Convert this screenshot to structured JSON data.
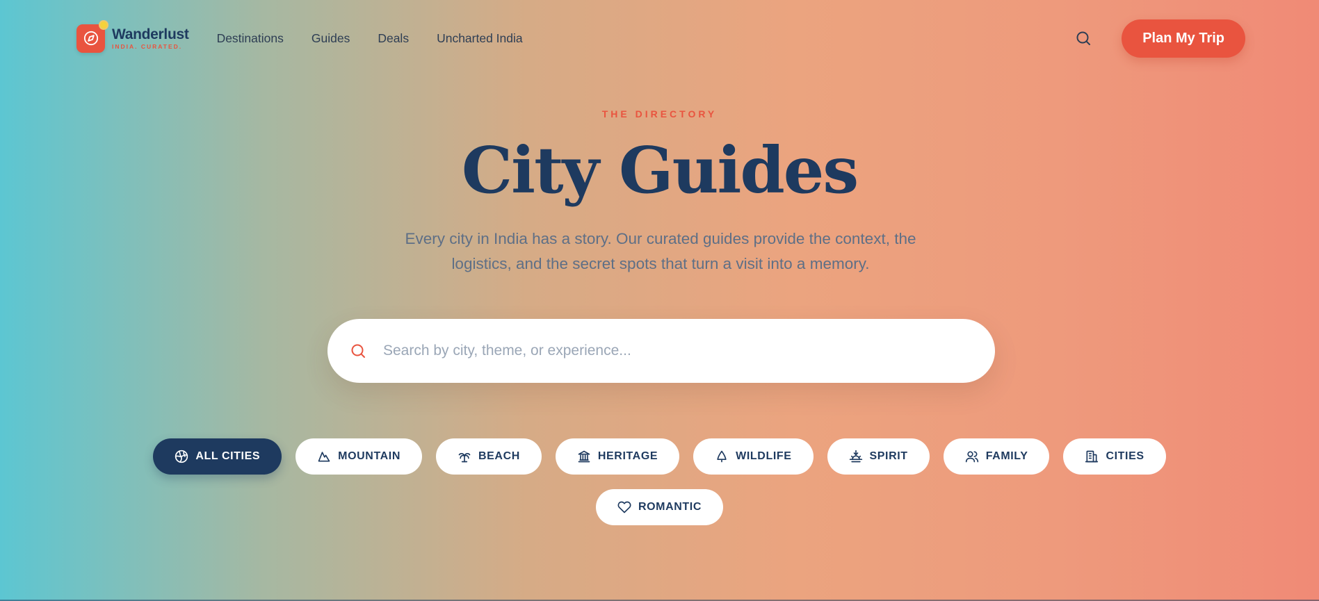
{
  "brand": {
    "name": "Wanderlust",
    "tagline": "INDIA. CURATED.",
    "accent": "#e9543f",
    "navy": "#1e3a5f"
  },
  "nav": {
    "links": [
      "Destinations",
      "Guides",
      "Deals",
      "Uncharted India"
    ],
    "search_icon": "search-icon",
    "cta": "Plan My Trip"
  },
  "hero": {
    "eyebrow": "THE DIRECTORY",
    "title": "City Guides",
    "subtitle": "Every city in India has a story. Our curated guides provide the context, the logistics, and the secret spots that turn a visit into a memory."
  },
  "search": {
    "placeholder": "Search by city, theme, or experience...",
    "value": ""
  },
  "filters": [
    {
      "label": "ALL CITIES",
      "icon": "globe-icon",
      "active": true
    },
    {
      "label": "MOUNTAIN",
      "icon": "mountain-icon",
      "active": false
    },
    {
      "label": "BEACH",
      "icon": "palm-tree-icon",
      "active": false
    },
    {
      "label": "HERITAGE",
      "icon": "landmark-icon",
      "active": false
    },
    {
      "label": "WILDLIFE",
      "icon": "tree-icon",
      "active": false
    },
    {
      "label": "SPIRIT",
      "icon": "sunrise-icon",
      "active": false
    },
    {
      "label": "FAMILY",
      "icon": "users-icon",
      "active": false
    },
    {
      "label": "CITIES",
      "icon": "building-icon",
      "active": false
    },
    {
      "label": "ROMANTIC",
      "icon": "heart-icon",
      "active": false
    }
  ]
}
